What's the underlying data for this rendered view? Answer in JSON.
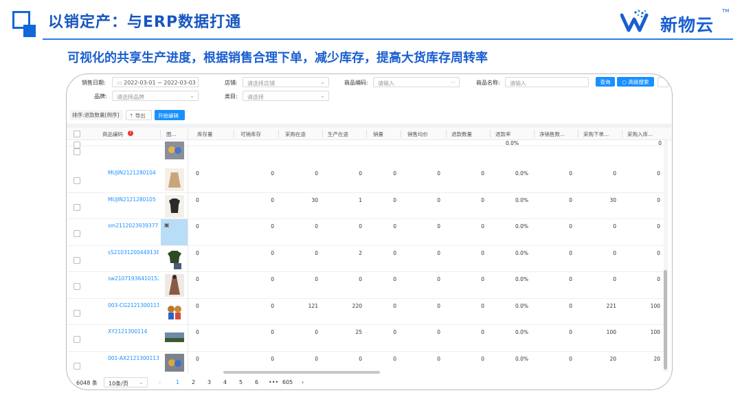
{
  "header": {
    "title": "以销定产：与ERP数据打通",
    "subtitle": "可视化的共享生产进度，根据销售合理下单，减少库存，提高大货库存周转率",
    "brand_name": "新物云",
    "brand_tm": "TM"
  },
  "colors": {
    "accent": "#1a5fd0",
    "link": "#1890ff",
    "button": "#1890ff"
  },
  "filters": {
    "sale_date_label": "销售日期:",
    "sale_date_value": "2022-03-01 ~ 2022-03-03",
    "store_label": "店铺:",
    "store_placeholder": "请选择店铺",
    "code_label": "商品编码:",
    "code_placeholder": "请输入",
    "name_label": "商品名称:",
    "name_placeholder": "请输入",
    "brand_label": "品牌:",
    "brand_placeholder": "请选择品牌",
    "category_label": "类目:",
    "category_placeholder": "请选择",
    "query_button": "查询",
    "advanced_button": "高级搜索"
  },
  "toolbar": {
    "sort_label": "排序:退款数量[倒序]",
    "export_label": "导出",
    "edit_label": "开始编辑"
  },
  "columns": [
    "商品编码",
    "图...",
    "库存量",
    "可销库存",
    "采购在途",
    "生产在途",
    "销量",
    "销售均价",
    "退款数量",
    "退款率",
    "净销售数...",
    "采购下单...",
    "采购入库..."
  ],
  "rows": [
    {
      "code": "MUJIN2121280104",
      "thumb": "sweater-image",
      "vals": [
        "0",
        "0",
        "0",
        "0",
        "0",
        "0",
        "0",
        "0.0%",
        "0",
        "0",
        "0"
      ]
    },
    {
      "code": "MUJIN2121280105",
      "thumb": "tshirt-image",
      "vals": [
        "0",
        "0",
        "30",
        "1",
        "0",
        "0",
        "0",
        "0.0%",
        "0",
        "30",
        "0"
      ]
    },
    {
      "code": "sm2112023939377213",
      "thumb": "placeholder-image",
      "vals": [
        "0",
        "0",
        "0",
        "0",
        "0",
        "0",
        "0",
        "0.0%",
        "0",
        "0",
        "0"
      ]
    },
    {
      "code": "sS2103120044913800",
      "thumb": "green-shirt-image",
      "vals": [
        "0",
        "0",
        "0",
        "2",
        "0",
        "0",
        "0",
        "0.0%",
        "0",
        "0",
        "0"
      ]
    },
    {
      "code": "sw2107193641015223",
      "thumb": "dress-image",
      "vals": [
        "0",
        "0",
        "0",
        "0",
        "0",
        "0",
        "0",
        "0.0%",
        "0",
        "0",
        "0"
      ]
    },
    {
      "code": "003-CG2121300111",
      "thumb": "toy-image",
      "vals": [
        "0",
        "0",
        "121",
        "220",
        "0",
        "0",
        "0",
        "0.0%",
        "0",
        "221",
        "100"
      ]
    },
    {
      "code": "XY2121300114",
      "thumb": "landscape-image",
      "vals": [
        "0",
        "0",
        "0",
        "25",
        "0",
        "0",
        "0",
        "0.0%",
        "0",
        "100",
        "100"
      ]
    },
    {
      "code": "001-AX2121300113",
      "thumb": "toy-box-image",
      "vals": [
        "0",
        "0",
        "0",
        "0",
        "0",
        "0",
        "0",
        "0.0%",
        "0",
        "20",
        "20"
      ]
    }
  ],
  "top_partial_row": {
    "vals": [
      "0.0%",
      "0"
    ]
  },
  "pagination": {
    "total": "6048 条",
    "page_size": "10条/页",
    "pages": [
      "1",
      "2",
      "3",
      "4",
      "5",
      "6",
      "•••",
      "605"
    ],
    "prev": "‹",
    "next": "›"
  }
}
